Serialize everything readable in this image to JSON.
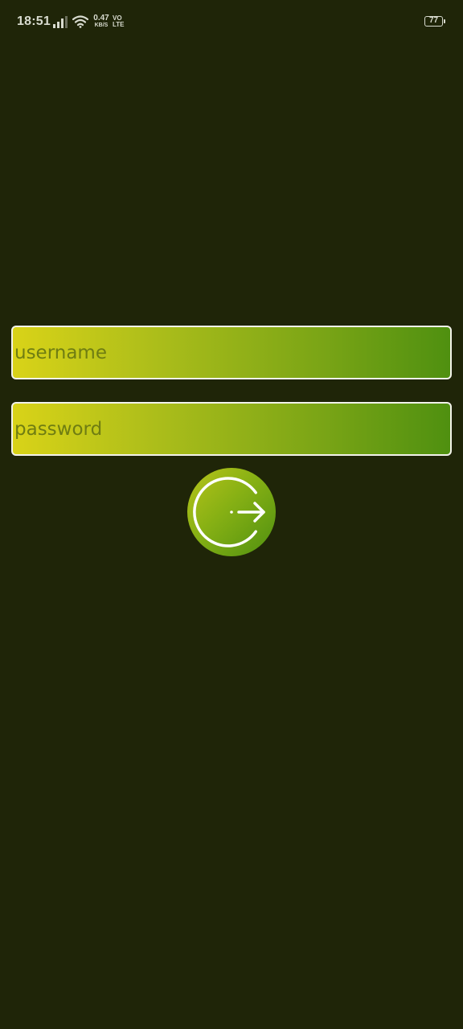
{
  "status_bar": {
    "time": "18:51",
    "net_speed_value": "0.47",
    "net_speed_unit": "KB/S",
    "volte_top": "VO",
    "volte_bottom": "LTE",
    "battery": "77"
  },
  "login_form": {
    "username_placeholder": "username",
    "password_placeholder": "password",
    "submit_icon": "login-arrow-icon"
  },
  "colors": {
    "background": "#1f2508",
    "gradient_start": "#d9d318",
    "gradient_end": "#4f9010",
    "border": "#f2f2ea"
  }
}
